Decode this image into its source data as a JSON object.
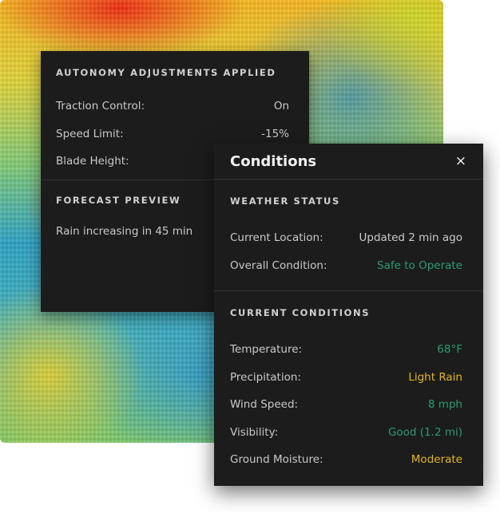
{
  "autonomy": {
    "heading": "AUTONOMY ADJUSTMENTS APPLIED",
    "rows": [
      {
        "label": "Traction Control:",
        "value": "On"
      },
      {
        "label": "Speed Limit:",
        "value": "-15%"
      },
      {
        "label": "Blade Height:",
        "value": ""
      }
    ],
    "forecast_heading": "FORECAST PREVIEW",
    "forecast_text": "Rain increasing in 45 min"
  },
  "conditions": {
    "title": "Conditions",
    "close_label": "×",
    "weather": {
      "heading": "WEATHER STATUS",
      "rows": [
        {
          "label": "Current Location:",
          "value": "Updated 2 min ago",
          "color": "#c9c9c9"
        },
        {
          "label": "Overall Condition:",
          "value": "Safe to Operate",
          "color": "#2a9d70"
        }
      ]
    },
    "current": {
      "heading": "CURRENT CONDITIONS",
      "rows": [
        {
          "label": "Temperature:",
          "value": "68°F",
          "color": "#2a9d70"
        },
        {
          "label": "Precipitation:",
          "value": "Light Rain",
          "color": "#e3b719"
        },
        {
          "label": "Wind Speed:",
          "value": "8 mph",
          "color": "#2a9d70"
        },
        {
          "label": "Visibility:",
          "value": "Good (1.2 mi)",
          "color": "#2a9d70"
        },
        {
          "label": "Ground Moisture:",
          "value": "Moderate",
          "color": "#e3b719"
        }
      ]
    }
  }
}
